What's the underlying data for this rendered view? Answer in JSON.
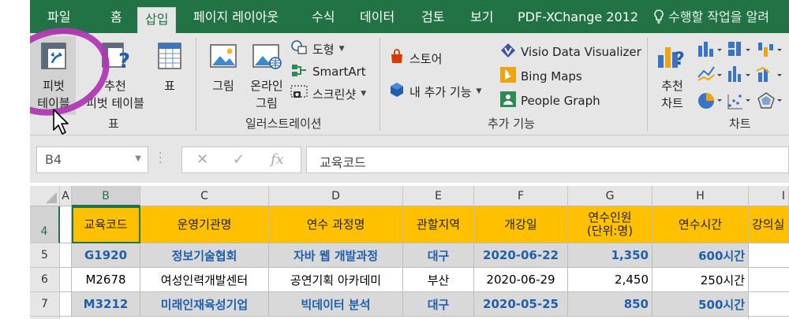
{
  "tabs": [
    "파일",
    "홈",
    "삽입",
    "페이지 레이아웃",
    "수식",
    "데이터",
    "검토",
    "보기",
    "PDF-XChange 2012"
  ],
  "active_tab": "삽입",
  "tell_me": "수행할 작업을 알려",
  "ribbon": {
    "tables": {
      "label": "표",
      "pivot_line1": "피벗",
      "pivot_line2": "테이블",
      "recommended_line1": "추천",
      "recommended_line2": "피벗 테이블",
      "table": "표"
    },
    "illustrations": {
      "label": "일러스트레이션",
      "picture": "그림",
      "online_line1": "온라인",
      "online_line2": "그림",
      "shapes": "도형",
      "smartart": "SmartArt",
      "screenshot": "스크린샷"
    },
    "addins": {
      "label": "추가 기능",
      "store": "스토어",
      "my_addins": "내 추가 기능",
      "visio": "Visio Data Visualizer",
      "bing": "Bing Maps",
      "people": "People Graph"
    },
    "charts": {
      "label": "차트",
      "recommended_line1": "추천",
      "recommended_line2": "차트"
    }
  },
  "formula_bar": {
    "name_box": "B4",
    "fx": "fx",
    "content": "교육코드"
  },
  "columns": [
    "A",
    "B",
    "C",
    "D",
    "E",
    "F",
    "G",
    "H",
    "I"
  ],
  "rows": [
    "4",
    "5",
    "6",
    "7"
  ],
  "headers": [
    "교육코드",
    "운영기관명",
    "연수 과정명",
    "관할지역",
    "개강일",
    "연수인원",
    "(단위:명)",
    "연수시간",
    "강의실"
  ],
  "data": [
    [
      "G1920",
      "정보기술협회",
      "자바 웹 개발과정",
      "대구",
      "2020-06-22",
      "1,350",
      "600시간"
    ],
    [
      "M2678",
      "여성인력개발센터",
      "공연기획 아카데미",
      "부산",
      "2020-06-29",
      "2,450",
      "250시간"
    ],
    [
      "M3212",
      "미래인재육성기업",
      "빅데이터 분석",
      "대구",
      "2020-05-25",
      "850",
      "500시간"
    ]
  ],
  "colors": {
    "accent": "#217346",
    "header_fill": "#ffc000",
    "highlight_text": "#1f5fae",
    "annotation": "#b039b3"
  }
}
